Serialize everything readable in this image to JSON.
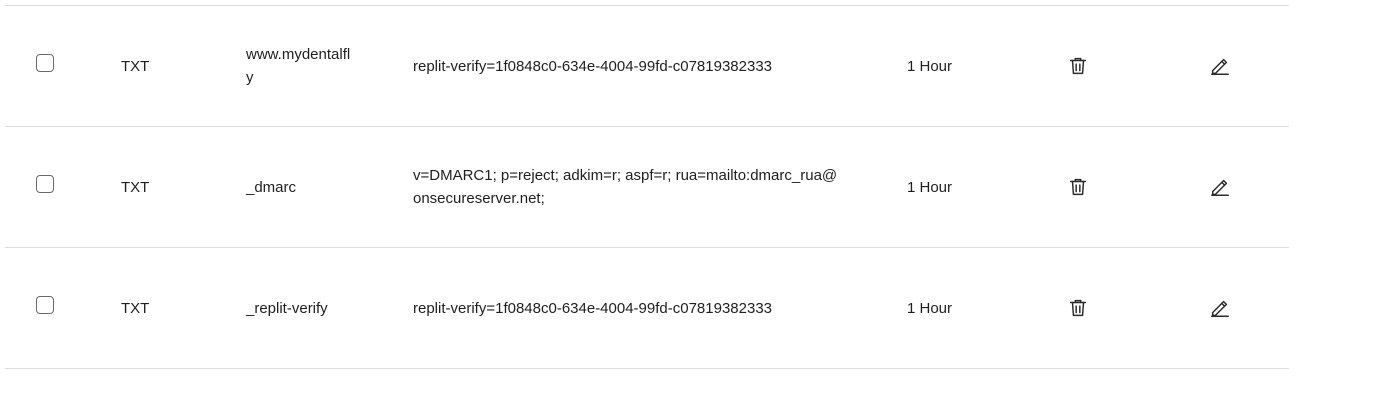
{
  "records": [
    {
      "type": "TXT",
      "name": "www.mydentalfly",
      "value": "replit-verify=1f0848c0-634e-4004-99fd-c07819382333",
      "ttl": "1 Hour",
      "delete_icon": "trash-icon",
      "edit_icon": "pencil-icon"
    },
    {
      "type": "TXT",
      "name": "_dmarc",
      "value": "v=DMARC1; p=reject; adkim=r; aspf=r; rua=mailto:dmarc_rua@onsecureserver.net;",
      "ttl": "1 Hour",
      "delete_icon": "trash-icon",
      "edit_icon": "pencil-icon"
    },
    {
      "type": "TXT",
      "name": "_replit-verify",
      "value": "replit-verify=1f0848c0-634e-4004-99fd-c07819382333",
      "ttl": "1 Hour",
      "delete_icon": "trash-icon",
      "edit_icon": "pencil-icon"
    }
  ],
  "colors": {
    "text": "#1f1f1f",
    "divider": "#dcdcdc",
    "icon": "#2b2b2b"
  }
}
